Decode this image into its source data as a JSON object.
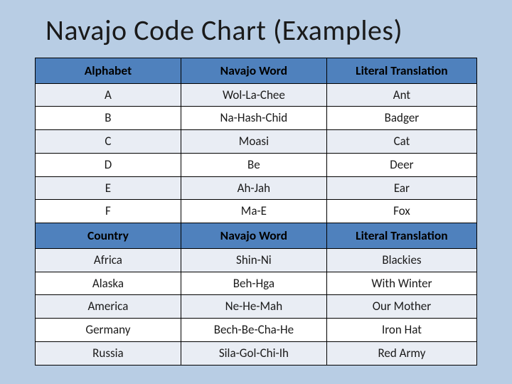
{
  "title": "Navajo Code Chart (Examples)",
  "table1": {
    "headers": [
      "Alphabet",
      "Navajo Word",
      "Literal Translation"
    ],
    "rows": [
      [
        "A",
        "Wol-La-Chee",
        "Ant"
      ],
      [
        "B",
        "Na-Hash-Chid",
        "Badger"
      ],
      [
        "C",
        "Moasi",
        "Cat"
      ],
      [
        "D",
        "Be",
        "Deer"
      ],
      [
        "E",
        "Ah-Jah",
        "Ear"
      ],
      [
        "F",
        "Ma-E",
        "Fox"
      ]
    ]
  },
  "table2": {
    "headers": [
      "Country",
      "Navajo Word",
      "Literal Translation"
    ],
    "rows": [
      [
        "Africa",
        "Shin-Ni",
        "Blackies"
      ],
      [
        "Alaska",
        "Beh-Hga",
        "With Winter"
      ],
      [
        "America",
        "Ne-He-Mah",
        "Our Mother"
      ],
      [
        "Germany",
        "Bech-Be-Cha-He",
        "Iron Hat"
      ],
      [
        "Russia",
        "Sila-Gol-Chi-Ih",
        "Red Army"
      ]
    ]
  }
}
